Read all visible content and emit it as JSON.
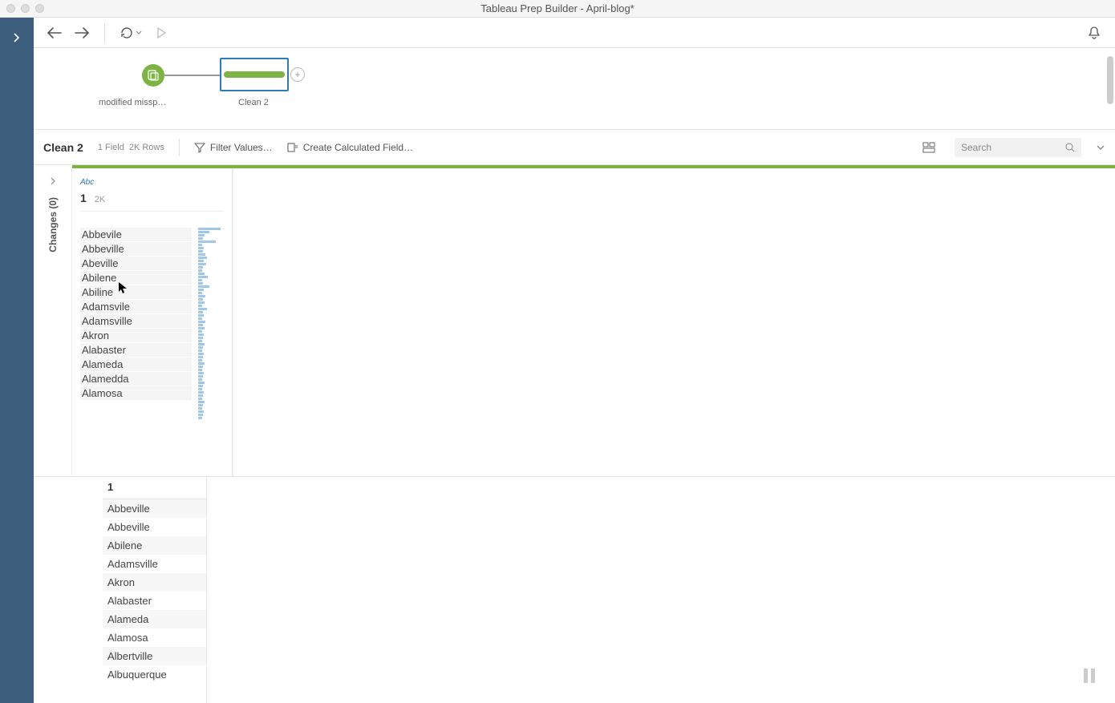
{
  "window": {
    "title": "Tableau Prep Builder - April-blog*"
  },
  "flow": {
    "input_label": "modified missp…",
    "step_label": "Clean 2"
  },
  "step_header": {
    "title": "Clean 2",
    "fields_text": "1 Field",
    "rows_text": "2K Rows",
    "filter_label": "Filter Values…",
    "calc_label": "Create Calculated Field…",
    "search_placeholder": "Search"
  },
  "changes_panel": {
    "label": "Changes (0)"
  },
  "profile_card": {
    "type_label": "Abc",
    "field_name": "1",
    "count_text": "2K",
    "values": [
      "Abbevile",
      "Abbeville",
      "Abeville",
      "Abilene",
      "Abiline",
      "Adamsvile",
      "Adamsville",
      "Akron",
      "Alabaster",
      "Alameda",
      "Alamedda",
      "Alamosa"
    ]
  },
  "grid": {
    "header": "1",
    "rows": [
      "Abbeville",
      "Abbeville",
      "Abilene",
      "Adamsville",
      "Akron",
      "Alabaster",
      "Alameda",
      "Alamosa",
      "Albertville",
      "Albuquerque"
    ]
  }
}
